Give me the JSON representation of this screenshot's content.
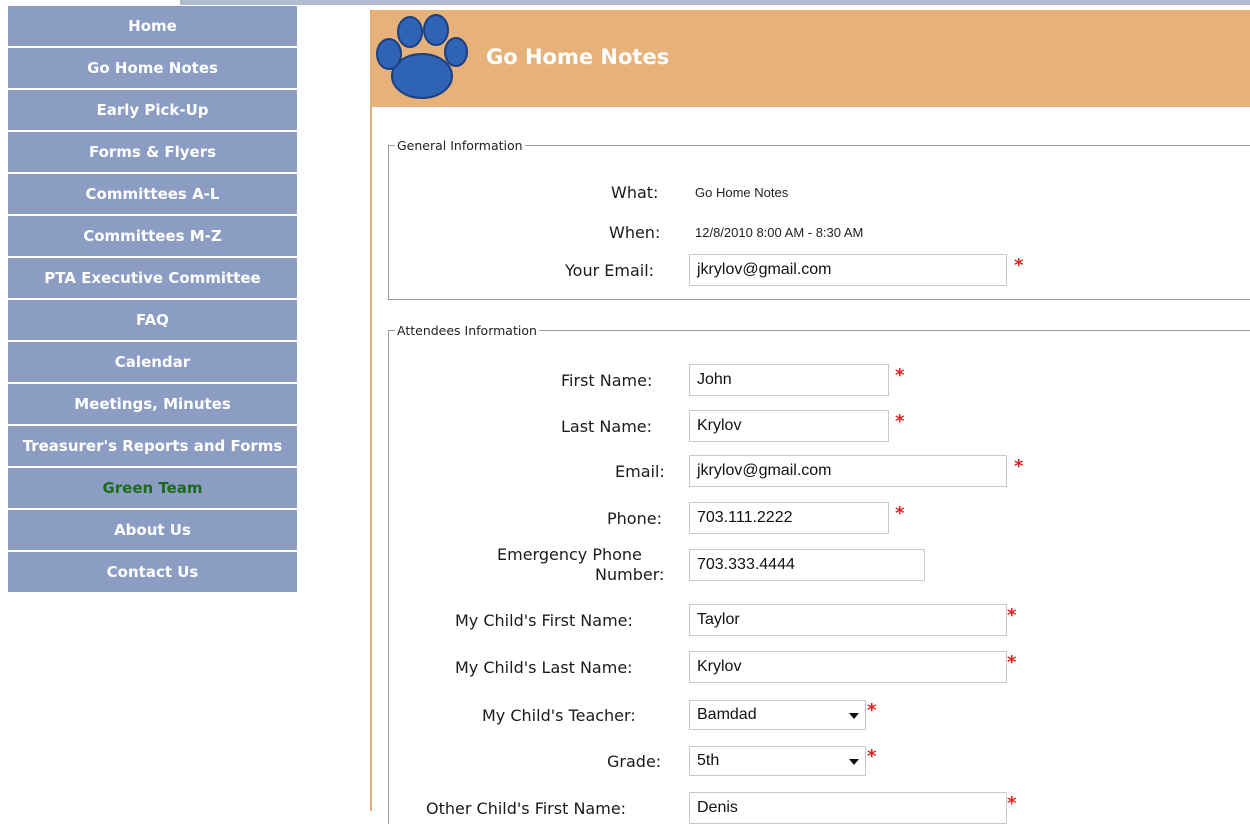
{
  "nav": {
    "items": [
      {
        "label": "Home"
      },
      {
        "label": "Go Home Notes"
      },
      {
        "label": "Early Pick-Up"
      },
      {
        "label": "Forms & Flyers"
      },
      {
        "label": "Committees A-L"
      },
      {
        "label": "Committees M-Z"
      },
      {
        "label": "PTA Executive Committee"
      },
      {
        "label": "FAQ"
      },
      {
        "label": "Calendar"
      },
      {
        "label": "Meetings, Minutes"
      },
      {
        "label": "Treasurer's Reports and Forms"
      },
      {
        "label": "Green Team"
      },
      {
        "label": "About Us"
      },
      {
        "label": "Contact Us"
      }
    ],
    "active_label": "Green Team"
  },
  "banner": {
    "title": "Go Home Notes"
  },
  "general": {
    "legend": "General Information",
    "what_label": "What:",
    "what_value": "Go Home Notes",
    "when_label": "When:",
    "when_value": "12/8/2010 8:00 AM - 8:30 AM",
    "email_label": "Your Email:",
    "email_value": "jkrylov@gmail.com"
  },
  "attendees": {
    "legend": "Attendees Information",
    "first_name_label": "First Name:",
    "first_name_value": "John",
    "last_name_label": "Last Name:",
    "last_name_value": "Krylov",
    "email_label": "Email:",
    "email_value": "jkrylov@gmail.com",
    "phone_label": "Phone:",
    "phone_value": "703.111.2222",
    "emergency_label_line1": "Emergency Phone",
    "emergency_label_line2": "Number:",
    "emergency_value": "703.333.4444",
    "child_first_label": "My Child's First Name:",
    "child_first_value": "Taylor",
    "child_last_label": "My Child's Last Name:",
    "child_last_value": "Krylov",
    "teacher_label": "My Child's Teacher:",
    "teacher_value": "Bamdad",
    "grade_label": "Grade:",
    "grade_value": "5th",
    "other_child_label": "Other Child's First Name:",
    "other_child_value": "Denis"
  },
  "required_mark": "*",
  "colors": {
    "nav_bg": "#8b9dc3",
    "nav_active_text": "#1c6b1c",
    "banner_bg": "#e7b17a",
    "required": "#e02020"
  }
}
